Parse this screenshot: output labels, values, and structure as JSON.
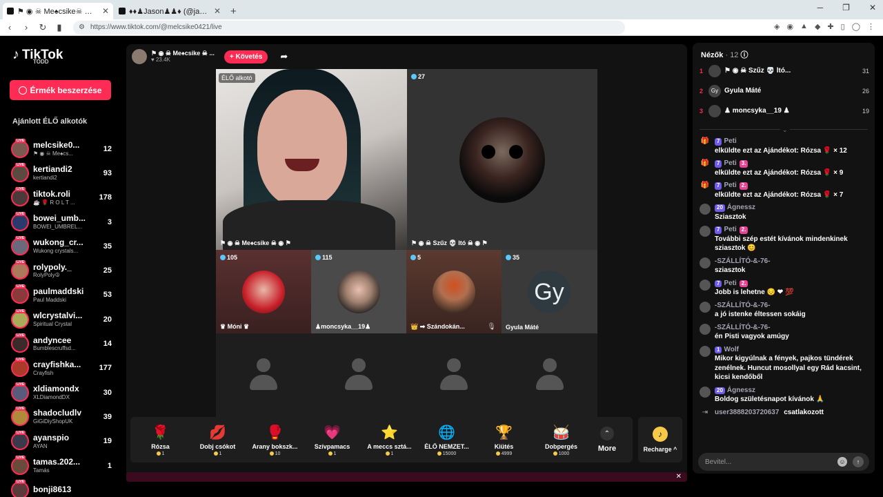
{
  "browser": {
    "tabs": [
      {
        "label": "⚑ ◉ ☠ Me♠csike☠ ◉ ⚑",
        "active": true
      },
      {
        "label": "♦♦♟Jason♟♟♦ (@jason_san",
        "active": false
      }
    ],
    "url": "https://www.tiktok.com/@melcsike0421/live"
  },
  "sidebar": {
    "logo": "TikTok",
    "logo_sub": "TODD",
    "coin_button": "Érmék beszerzése",
    "section_title": "Ajánlott ÉLŐ alkotók",
    "live_tag": "LIVE",
    "creators": [
      {
        "name": "melcsike0...",
        "sub": "⚑ ◉ ☠ Me♠cs...",
        "count": "12",
        "color": "#7a5a50"
      },
      {
        "name": "kertiandi2",
        "sub": "kertiandi2",
        "count": "93",
        "color": "#5a4a40"
      },
      {
        "name": "tiktok.roli",
        "sub": "☕ 🌹 R O L T ...",
        "count": "178",
        "color": "#4a3a3a"
      },
      {
        "name": "bowei_umb...",
        "sub": "BOWEI_UMBREL...",
        "count": "3",
        "color": "#2a3a6a"
      },
      {
        "name": "wukong_cr...",
        "sub": "Wukong crystals...",
        "count": "35",
        "color": "#6a6a7a"
      },
      {
        "name": "rolypoly._",
        "sub": "RolyPoly☮",
        "count": "25",
        "color": "#aa7a5a"
      },
      {
        "name": "paulmaddski",
        "sub": "Paul Maddski",
        "count": "53",
        "color": "#8a3a3a"
      },
      {
        "name": "wlcrystalvi...",
        "sub": "Spiritual Crystal",
        "count": "20",
        "color": "#aaaa5a"
      },
      {
        "name": "andyncee",
        "sub": "Bumblescruffsd...",
        "count": "14",
        "color": "#3a2a2a"
      },
      {
        "name": "crayfishka...",
        "sub": "Crayfish",
        "count": "177",
        "color": "#aa3a2a"
      },
      {
        "name": "xldiamondx",
        "sub": "XLDiamondDX",
        "count": "30",
        "color": "#5a5a7a"
      },
      {
        "name": "shadocludlv",
        "sub": "GiGiDiyShopUK",
        "count": "39",
        "color": "#b08a3a"
      },
      {
        "name": "ayanspio",
        "sub": "AYAN",
        "count": "19",
        "color": "#3a3a4a"
      },
      {
        "name": "tamas.202...",
        "sub": "Tamás",
        "count": "1",
        "color": "#6a4a3a"
      },
      {
        "name": "bonji8613",
        "sub": "",
        "count": "",
        "color": "#5a3a3a"
      }
    ]
  },
  "stream": {
    "host_name": "⚑ ◉ ☠ Me♠csike ☠ ...",
    "host_likes": "♥ 23.4K",
    "follow": "+ Követés",
    "main_badge": "ÉLŐ alkotó",
    "main_label": "⚑ ◉ ☠ Me♠csike ☠ ◉ ⚑",
    "guest_badge": "27",
    "guest_label": "⚑ ◉ ☠ Szűz 💀 ltó ☠ ◉ ⚑",
    "small": [
      {
        "badge": "105",
        "label": "♛ Móni ♛"
      },
      {
        "badge": "115",
        "label": "♟moncsyka__19♟"
      },
      {
        "badge": "5",
        "label": "👑 ➡ Szándokán..."
      },
      {
        "badge": "35",
        "label": "Gyula Máté",
        "initials": "Gy"
      }
    ]
  },
  "gifts": [
    {
      "name": "Rózsa",
      "price": "1",
      "icon": "rose-icon",
      "glyph": "🌹"
    },
    {
      "name": "Dobj csókot",
      "price": "1",
      "icon": "kiss-icon",
      "glyph": "💋"
    },
    {
      "name": "Arany bokszk...",
      "price": "10",
      "icon": "glove-icon",
      "glyph": "🥊"
    },
    {
      "name": "Szívpamacs",
      "price": "1",
      "icon": "heart-icon",
      "glyph": "💗"
    },
    {
      "name": "A meccs sztá...",
      "price": "1",
      "icon": "star-icon",
      "glyph": "⭐"
    },
    {
      "name": "ÉLŐ NEMZET...",
      "price": "15000",
      "icon": "globe-icon",
      "glyph": "🌐"
    },
    {
      "name": "Kiütés",
      "price": "4999",
      "icon": "ko-icon",
      "glyph": "🏆"
    },
    {
      "name": "Dobpergés",
      "price": "1000",
      "icon": "drum-icon",
      "glyph": "🥁"
    }
  ],
  "gift_more": "More",
  "recharge": "Recharge ^",
  "chat": {
    "viewers_label": "Nézők",
    "viewers_count": "· 12",
    "top_viewers": [
      {
        "rank": "1",
        "name": "⚑ ◉ ☠ Szűz 💀 ltó...",
        "score": "31"
      },
      {
        "rank": "2",
        "name": "Gyula Máté",
        "score": "26",
        "initials": "Gy"
      },
      {
        "rank": "3",
        "name": "♟ moncsyka__19 ♟",
        "score": "19"
      }
    ],
    "messages": [
      {
        "type": "gift",
        "lvl": "7",
        "user": "Peti",
        "fan": "",
        "text": "elküldte ezt az Ajándékot: Rózsa 🌹 × 12"
      },
      {
        "type": "gift",
        "lvl": "7",
        "user": "Peti",
        "fan": "3.",
        "text": "elküldte ezt az Ajándékot: Rózsa 🌹 × 9"
      },
      {
        "type": "gift",
        "lvl": "7",
        "user": "Peti",
        "fan": "2.",
        "text": "elküldte ezt az Ajándékot: Rózsa 🌹 × 7"
      },
      {
        "type": "chat",
        "lvl": "20",
        "user": "Ágnessz",
        "fan": "",
        "text": "Sziasztok"
      },
      {
        "type": "chat",
        "lvl": "7",
        "user": "Peti",
        "fan": "2.",
        "text": "További szép estét kívánok mindenkinek sziasztok 😊"
      },
      {
        "type": "chat",
        "lvl": "",
        "user": "-SZÁLLÍTÓ-&-76-",
        "fan": "",
        "text": "sziasztok"
      },
      {
        "type": "chat",
        "lvl": "7",
        "user": "Peti",
        "fan": "2.",
        "text": "Jobb is lehetne 😔 ❤ 💯"
      },
      {
        "type": "chat",
        "lvl": "",
        "user": "-SZÁLLÍTÓ-&-76-",
        "fan": "",
        "text": "a jó istenke éltessen sokáig"
      },
      {
        "type": "chat",
        "lvl": "",
        "user": "-SZÁLLÍTÓ-&-76-",
        "fan": "",
        "text": "én Pisti vagyok amúgy"
      },
      {
        "type": "chat",
        "lvl": "1",
        "user": "Wolf",
        "fan": "",
        "text": "Mikor kigyúlnak a fények, pajkos tündérek zenélnek. Huncut mosollyal egy Rád kacsint, kicsi kendőből"
      },
      {
        "type": "chat",
        "lvl": "20",
        "user": "Ágnessz",
        "fan": "",
        "text": "Boldog születésnapot kívánok 🙏"
      },
      {
        "type": "join",
        "lvl": "",
        "user": "user3888203720637",
        "fan": "",
        "text": "csatlakozott"
      }
    ],
    "input_placeholder": "Bevitel..."
  }
}
